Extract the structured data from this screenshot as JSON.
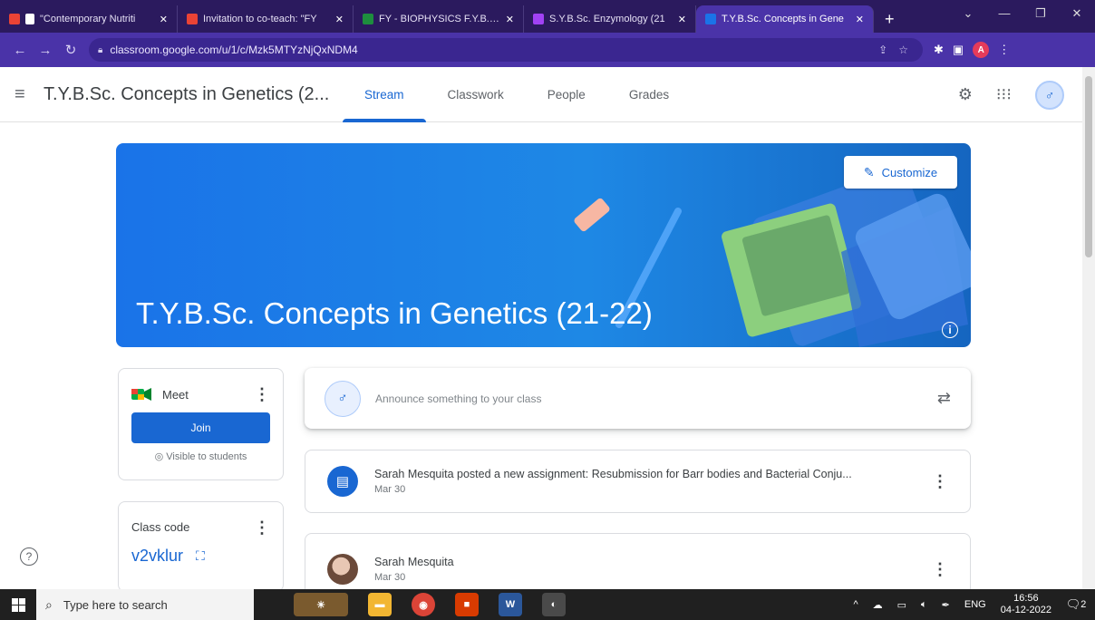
{
  "browser": {
    "tabs": [
      {
        "title": "\"Contemporary Nutriti",
        "icon": "gmail-icon",
        "color": "#ea4335",
        "active": false
      },
      {
        "title": "Invitation to co-teach: \"FY",
        "icon": "gmail-icon",
        "color": "#ea4335",
        "active": false
      },
      {
        "title": "FY - BIOPHYSICS F.Y.B.Sc.",
        "icon": "classroom-icon",
        "color": "#1e8e3e",
        "active": false
      },
      {
        "title": "S.Y.B.Sc. Enzymology (21",
        "icon": "classroom-icon",
        "color": "#a142f4",
        "active": false
      },
      {
        "title": "T.Y.B.Sc. Concepts in Gene",
        "icon": "classroom-icon",
        "color": "#1a73e8",
        "active": true
      }
    ],
    "url": "classroom.google.com/u/1/c/Mzk5MTYzNjQxNDM4",
    "profile_initial": "A"
  },
  "header": {
    "class_title": "T.Y.B.Sc. Concepts in Genetics (2...",
    "tabs": [
      "Stream",
      "Classwork",
      "People",
      "Grades"
    ],
    "active_tab": "Stream"
  },
  "banner": {
    "title": "T.Y.B.Sc. Concepts in Genetics (21-22)",
    "customize_label": "Customize"
  },
  "meet": {
    "label": "Meet",
    "join_label": "Join",
    "visibility": "Visible to students"
  },
  "class_code": {
    "label": "Class code",
    "code": "v2vklur"
  },
  "announce": {
    "placeholder": "Announce something to your class"
  },
  "posts": [
    {
      "text": "Sarah Mesquita posted a new assignment: Resubmission for Barr bodies and Bacterial Conju...",
      "date": "Mar 30",
      "type": "assignment"
    },
    {
      "text": "Sarah Mesquita",
      "date": "Mar 30",
      "type": "announcement"
    }
  ],
  "taskbar": {
    "search_placeholder": "Type here to search",
    "language": "ENG",
    "time": "16:56",
    "date": "04-12-2022",
    "notification_count": "2"
  }
}
